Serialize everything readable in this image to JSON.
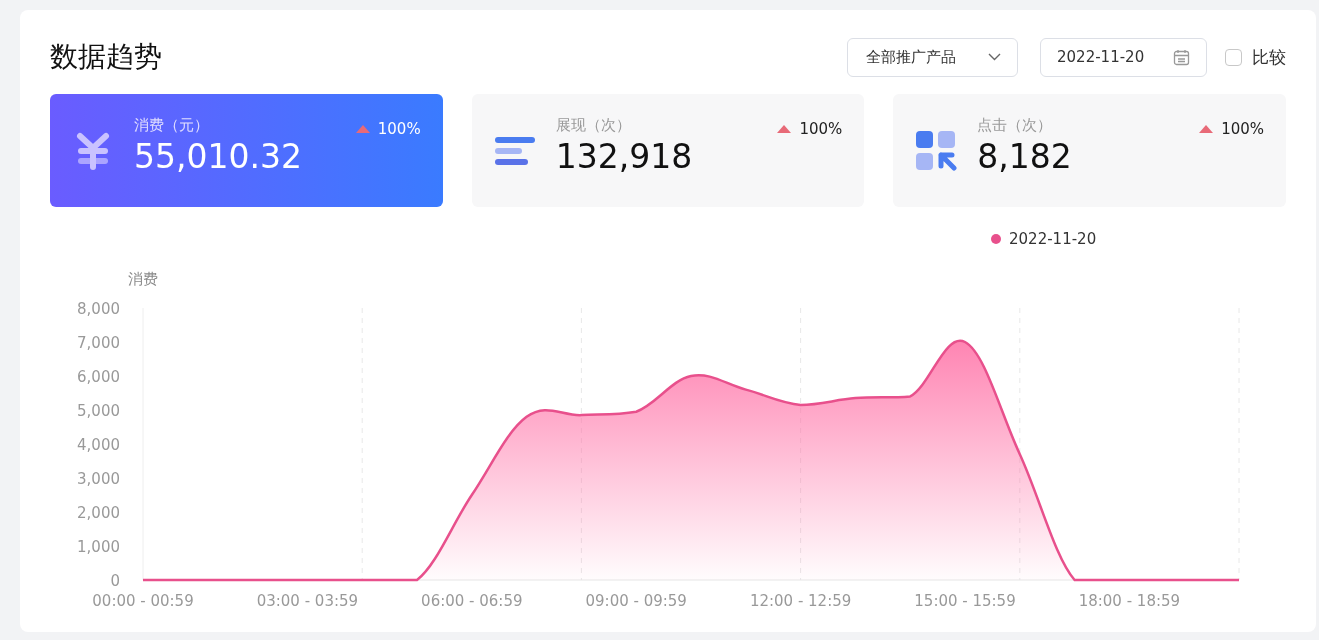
{
  "title": "数据趋势",
  "product_select": {
    "value": "全部推广产品"
  },
  "date_picker": {
    "value": "2022-11-20"
  },
  "compare": {
    "label": "比较",
    "checked": false
  },
  "metrics": [
    {
      "kind": "yen",
      "label": "消费（元）",
      "value": "55,010.32",
      "change": "100%",
      "selected": true
    },
    {
      "kind": "bars",
      "label": "展现（次）",
      "value": "132,918",
      "change": "100%",
      "selected": false
    },
    {
      "kind": "grid",
      "label": "点击（次）",
      "value": "8,182",
      "change": "100%",
      "selected": false
    }
  ],
  "chart_data": {
    "type": "area",
    "grid": true,
    "ylabel": "消费",
    "categories": [
      "00:00 - 00:59",
      null,
      null,
      "03:00 - 03:59",
      null,
      null,
      "06:00 - 06:59",
      null,
      null,
      "09:00 - 09:59",
      null,
      null,
      "12:00 - 12:59",
      null,
      null,
      "15:00 - 15:59",
      null,
      null,
      "18:00 - 18:59",
      null,
      null
    ],
    "series": [
      {
        "name": "2022-11-20",
        "color": "#e8508c",
        "values": [
          0,
          0,
          0,
          0,
          0,
          0,
          2500,
          4800,
          4850,
          4950,
          6000,
          5600,
          5150,
          5350,
          5400,
          7000,
          3700,
          0,
          0,
          0,
          0
        ]
      }
    ],
    "ylim": [
      0,
      8000
    ],
    "yticks": [
      {
        "value": 0,
        "label": "0"
      },
      {
        "value": 1000,
        "label": "1,000"
      },
      {
        "value": 2000,
        "label": "2,000"
      },
      {
        "value": 3000,
        "label": "3,000"
      },
      {
        "value": 4000,
        "label": "4,000"
      },
      {
        "value": 5000,
        "label": "5,000"
      },
      {
        "value": 6000,
        "label": "6,000"
      },
      {
        "value": 7000,
        "label": "7,000"
      },
      {
        "value": 8000,
        "label": "8,000"
      }
    ]
  }
}
